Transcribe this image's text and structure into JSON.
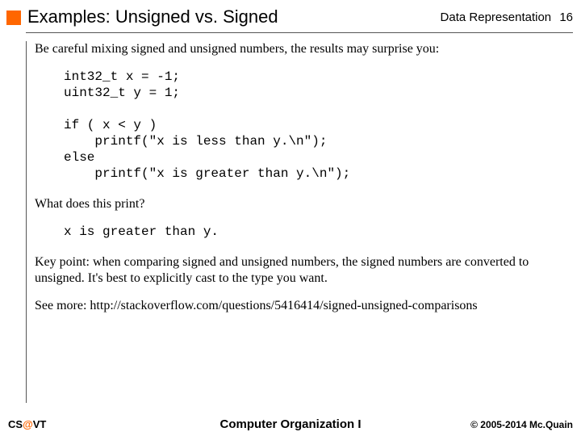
{
  "header": {
    "title": "Examples: Unsigned vs. Signed",
    "section": "Data Representation",
    "page": "16"
  },
  "body": {
    "intro": "Be careful mixing signed and unsigned numbers, the results may surprise you:",
    "code1": "int32_t x = -1;\nuint32_t y = 1;\n\nif ( x < y )\n    printf(\"x is less than y.\\n\");\nelse\n    printf(\"x is greater than y.\\n\");",
    "question": "What does this print?",
    "output": "x is greater than y.",
    "keypoint": "Key point: when comparing signed and unsigned numbers, the signed numbers are converted to unsigned. It's best to explicitly cast to the type you want.",
    "seemore": "See more: http://stackoverflow.com/questions/5416414/signed-unsigned-comparisons"
  },
  "footer": {
    "left_pre": "CS",
    "left_at": "@",
    "left_post": "VT",
    "center": "Computer Organization I",
    "right": "© 2005-2014 Mc.Quain"
  }
}
